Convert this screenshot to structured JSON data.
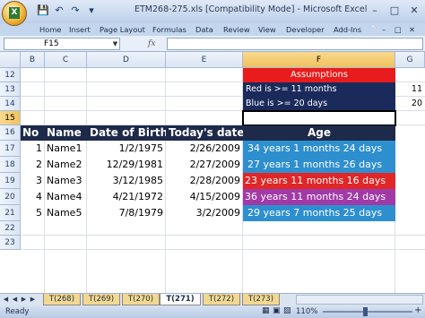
{
  "window": {
    "title": "ETM268-275.xls  [Compatibility Mode] - Microsoft Excel",
    "office_button_letter": "X",
    "min_glyph": "–",
    "restore_glyph": "□",
    "close_glyph": "✕"
  },
  "quick_access": [
    "save-icon",
    "undo-icon",
    "redo-icon",
    "customize-icon"
  ],
  "ribbon_tabs": [
    "Home",
    "Insert",
    "Page Layout",
    "Formulas",
    "Data",
    "Review",
    "View",
    "Developer",
    "Add-Ins"
  ],
  "formula_bar": {
    "name_box": "F15",
    "fx": "fx",
    "formula": ""
  },
  "columns": [
    "B",
    "C",
    "D",
    "E",
    "F",
    "G"
  ],
  "selected_column": "F",
  "rows": [
    "12",
    "13",
    "14",
    "15",
    "16",
    "17",
    "18",
    "19",
    "20",
    "21",
    "22",
    "23"
  ],
  "selected_row": "15",
  "assumptions": {
    "header": "Assumptions",
    "red_text": "Red is >= 11 months",
    "red_value": "11",
    "blue_text": "Blue is >= 20 days",
    "blue_value": "20"
  },
  "table": {
    "headers": {
      "no": "No",
      "name": "Name",
      "dob": "Date of Birth",
      "today": "Today's date",
      "age": "Age"
    },
    "rows": [
      {
        "no": "1",
        "name": "Name1",
        "dob": "1/2/1975",
        "today": "2/26/2009",
        "age": "34 years 1 months 24 days",
        "color": "#2e8fcf"
      },
      {
        "no": "2",
        "name": "Name2",
        "dob": "12/29/1981",
        "today": "2/27/2009",
        "age": "27 years 1 months 26 days",
        "color": "#2e8fcf"
      },
      {
        "no": "3",
        "name": "Name3",
        "dob": "3/12/1985",
        "today": "2/28/2009",
        "age": "23 years 11 months 16 days",
        "color": "#e02626"
      },
      {
        "no": "4",
        "name": "Name4",
        "dob": "4/21/1972",
        "today": "4/15/2009",
        "age": "36 years 11 months 24 days",
        "color": "#a03aa6"
      },
      {
        "no": "5",
        "name": "Name5",
        "dob": "7/8/1979",
        "today": "3/2/2009",
        "age": "29 years 7 months 25 days",
        "color": "#2e8fcf"
      }
    ]
  },
  "sheet_tabs": [
    "T(268)",
    "T(269)",
    "T(270)",
    "T(271)",
    "T(272)",
    "T(273)"
  ],
  "active_sheet": "T(271)",
  "status": {
    "ready": "Ready",
    "zoom": "110%"
  },
  "colors": {
    "accent_header": "#1e2a4a",
    "assumptions_red": "#e81c1c",
    "assumptions_blue": "#1a2a5a"
  }
}
